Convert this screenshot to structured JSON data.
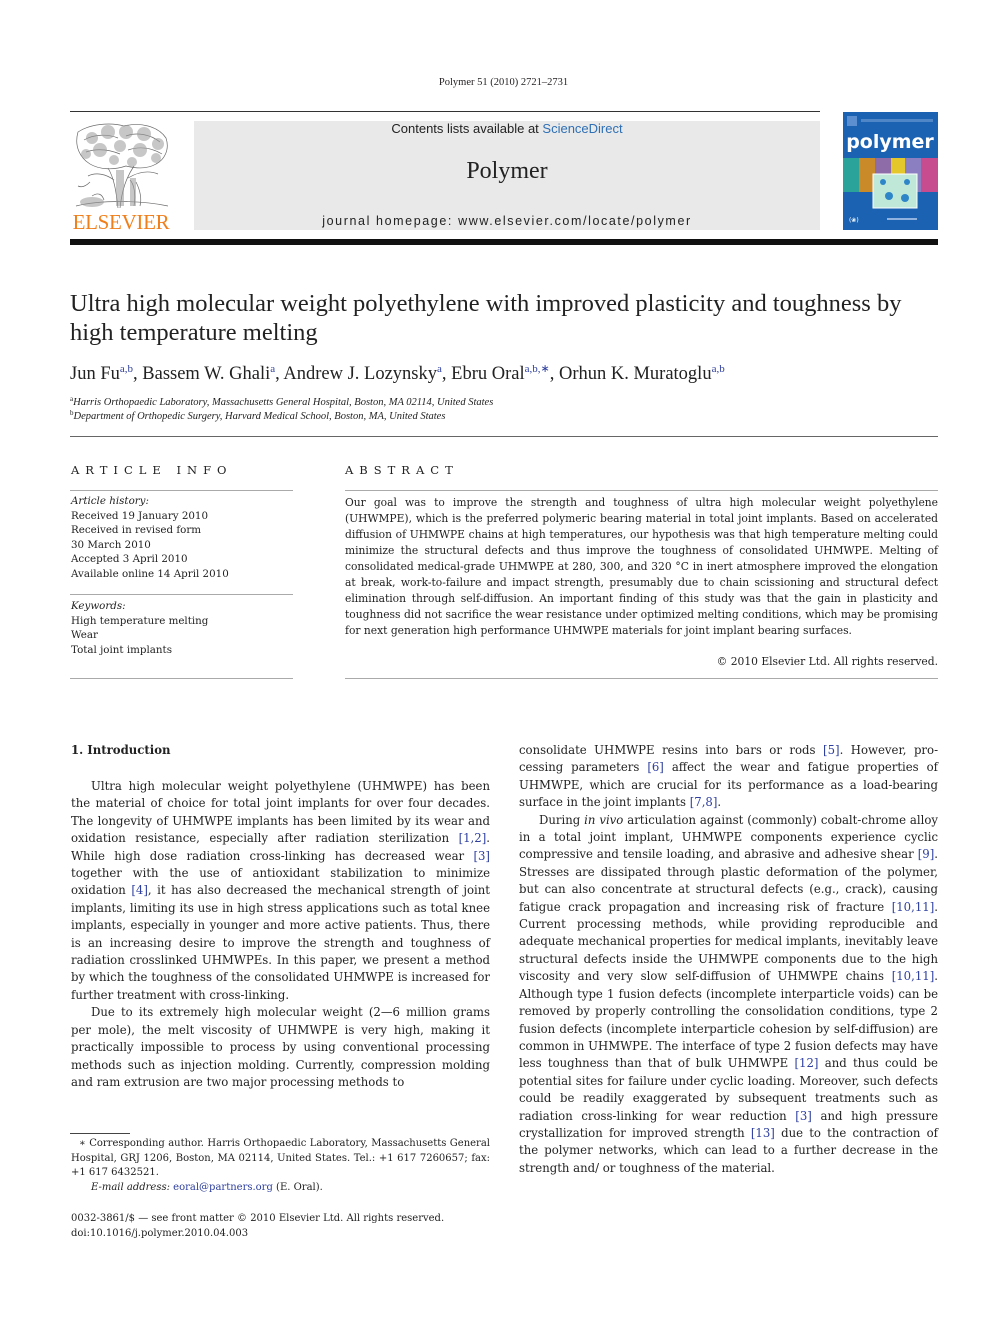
{
  "running_head": "Polymer 51 (2010) 2721–2731",
  "header": {
    "publisher_wordmark": "ELSEVIER",
    "contents_prefix": "Contents lists available at ",
    "contents_link": "ScienceDirect",
    "journal_name": "Polymer",
    "homepage_label": "journal homepage: ",
    "homepage_url": "www.elsevier.com/locate/polymer",
    "cover_title": "polymer",
    "colors": {
      "elsevier_orange": "#f07f1b",
      "cover_blue": "#1b63b2",
      "link_blue": "#2e3f9e",
      "band_grey": "#e9e9e9"
    }
  },
  "article": {
    "title": "Ultra high molecular weight polyethylene with improved plasticity and toughness by high temperature melting",
    "authors": [
      {
        "name": "Jun Fu",
        "sup": "a,b"
      },
      {
        "name": "Bassem W. Ghali",
        "sup": "a"
      },
      {
        "name": "Andrew J. Lozynsky",
        "sup": "a"
      },
      {
        "name": "Ebru Oral",
        "sup": "a,b,∗"
      },
      {
        "name": "Orhun K. Muratoglu",
        "sup": "a,b"
      }
    ],
    "affiliations": [
      {
        "key": "a",
        "text": "Harris Orthopaedic Laboratory, Massachusetts General Hospital, Boston, MA 02114, United States"
      },
      {
        "key": "b",
        "text": "Department of Orthopedic Surgery, Harvard Medical School, Boston, MA, United States"
      }
    ]
  },
  "article_info": {
    "heading": "ARTICLE INFO",
    "history_label": "Article history:",
    "history": [
      "Received 19 January 2010",
      "Received in revised form",
      "30 March 2010",
      "Accepted 3 April 2010",
      "Available online 14 April 2010"
    ],
    "keywords_label": "Keywords:",
    "keywords": [
      "High temperature melting",
      "Wear",
      "Total joint implants"
    ]
  },
  "abstract": {
    "heading": "ABSTRACT",
    "text": "Our goal was to improve the strength and toughness of ultra high molecular weight polyethylene (UHWMPE), which is the preferred polymeric bearing material in total joint implants. Based on accel­erated diffusion of UHMWPE chains at high temperatures, our hypothesis was that high temperature melting could minimize the structural defects and thus improve the toughness of consolidated UHMWPE. Melting of consolidated medical-grade UHMWPE at 280, 300, and 320 °C in inert atmosphere improved the elongation at break, work-to-failure and impact strength, presumably due to chain scis­sioning and structural defect elimination through self-diffusion. An important finding of this study was that the gain in plasticity and toughness did not sacrifice the wear resistance under optimized melting conditions, which may be promising for next generation high performance UHMWPE materials for joint implant bearing surfaces.",
    "copyright": "© 2010 Elsevier Ltd. All rights reserved."
  },
  "body": {
    "section_heading": "1.  Introduction",
    "left_paragraphs": [
      [
        {
          "t": "Ultra high molecular weight polyethylene (UHMWPE) has been the material of choice for total joint implants for over four decades. The longevity of UHMWPE implants has been limited by its wear and oxidation resistance, especially after radiation sterilization "
        },
        {
          "ref": "[1,2]"
        },
        {
          "t": ". While high dose radiation cross-linking has decreased wear "
        },
        {
          "ref": "[3]"
        },
        {
          "t": " together with the use of antioxidant stabilization to minimize oxidation "
        },
        {
          "ref": "[4]"
        },
        {
          "t": ", it has also decreased the mechanical strength of joint implants, limiting its use in high stress applications such as total knee implants, especially in younger and more active patients. Thus, there is an increasing desire to improve the strength and toughness of radiation crosslinked UHMWPEs. In this paper, we present a method by which the toughness of the consolidated UHMWPE is increased for further treatment with cross-linking."
        }
      ],
      [
        {
          "t": "Due to its extremely high molecular weight (2—6 million grams per mole), the melt viscosity of UHMWPE is very high, making it practically impossible to process by using conventional processing methods such as injection molding. Currently, compression molding and ram extrusion are two major processing methods to"
        }
      ]
    ],
    "right_paragraphs": [
      [
        {
          "t": "consolidate UHMWPE resins into bars or rods "
        },
        {
          "ref": "[5]"
        },
        {
          "t": ". However, pro­cessing parameters "
        },
        {
          "ref": "[6]"
        },
        {
          "t": " affect the wear and fatigue properties of UHMWPE, which are crucial for its performance as a load-bearing surface in the joint implants "
        },
        {
          "ref": "[7,8]"
        },
        {
          "t": "."
        }
      ],
      [
        {
          "t": "During "
        },
        {
          "i": "in vivo"
        },
        {
          "t": " articulation against (commonly) cobalt-chrome alloy in a total joint implant, UHMWPE components experience cyclic compressive and tensile loading, and abrasive and adhesive shear "
        },
        {
          "ref": "[9]"
        },
        {
          "t": ". Stresses are dissipated through plastic deformation of the polymer, but can also concentrate at structural defects (e.g., crack), causing fatigue crack propagation and increasing risk of fracture "
        },
        {
          "ref": "[10,11]"
        },
        {
          "t": ". Current processing methods, while providing reproducible and adequate mechanical properties for medical implants, inevi­tably leave structural defects inside the UHMWPE components due to the high viscosity and very slow self-diffusion of UHMWPE chains "
        },
        {
          "ref": "[10,11]"
        },
        {
          "t": ". Although type 1 fusion defects (incomplete inter­particle voids) can be removed by properly controlling the consolidation conditions, type 2 fusion defects (incomplete inter­particle cohesion by self-diffusion) are common in UHMWPE. The interface of type 2 fusion defects may have less toughness than that of bulk UHMWPE "
        },
        {
          "ref": "[12]"
        },
        {
          "t": " and thus could be potential sites for failure under cyclic loading. Moreover, such defects could be readily exaggerated by subsequent treatments such as radiation cross-linking for wear reduction "
        },
        {
          "ref": "[3]"
        },
        {
          "t": " and high pressure crystallization for improved strength "
        },
        {
          "ref": "[13]"
        },
        {
          "t": " due to the contraction of the polymer networks, which can lead to a further decrease in the strength and/ or toughness of the material."
        }
      ]
    ]
  },
  "footnote": {
    "corresponding": "∗ Corresponding author. Harris Orthopaedic Laboratory, Massachusetts General Hospital, GRJ 1206, Boston, MA 02114, United States. Tel.: +1 617 7260657; fax: +1 617 6432521.",
    "email_label": "E-mail address: ",
    "email": "eoral@partners.org",
    "email_suffix": " (E. Oral)."
  },
  "front_matter": {
    "issn_line": "0032-3861/$ — see front matter © 2010 Elsevier Ltd. All rights reserved.",
    "doi": "doi:10.1016/j.polymer.2010.04.003"
  }
}
